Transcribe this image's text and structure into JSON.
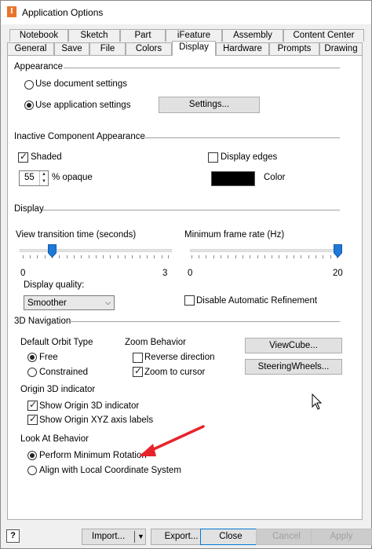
{
  "window": {
    "title": "Application Options",
    "app_icon_glyph": "I"
  },
  "tabs": {
    "row1": [
      "Notebook",
      "Sketch",
      "Part",
      "iFeature",
      "Assembly",
      "Content Center"
    ],
    "row2": [
      "General",
      "Save",
      "File",
      "Colors",
      "Display",
      "Hardware",
      "Prompts",
      "Drawing"
    ],
    "active": "Display"
  },
  "appearance": {
    "heading": "Appearance",
    "use_document": "Use document settings",
    "use_application": "Use application settings",
    "selected": "application",
    "settings_button": "Settings..."
  },
  "inactive": {
    "heading": "Inactive Component Appearance",
    "shaded_label": "Shaded",
    "shaded_checked": true,
    "opacity_value": "55",
    "opacity_suffix": "% opaque",
    "display_edges_label": "Display edges",
    "display_edges_checked": false,
    "color_label": "Color",
    "color_value": "#000000"
  },
  "display": {
    "heading": "Display",
    "view_transition_label": "View transition time (seconds)",
    "view_transition_min": "0",
    "view_transition_max": "3",
    "view_transition_value": 0.6,
    "min_frame_label": "Minimum frame rate (Hz)",
    "min_frame_min": "0",
    "min_frame_max": "20",
    "min_frame_value": 20,
    "quality_label": "Display quality:",
    "quality_value": "Smoother",
    "disable_refinement_label": "Disable Automatic Refinement",
    "disable_refinement_checked": false
  },
  "nav3d": {
    "heading": "3D Navigation",
    "orbit_heading": "Default Orbit Type",
    "orbit_free": "Free",
    "orbit_constrained": "Constrained",
    "orbit_selected": "free",
    "zoom_heading": "Zoom Behavior",
    "reverse_direction": "Reverse direction",
    "reverse_checked": false,
    "zoom_to_cursor": "Zoom to cursor",
    "zoom_to_cursor_checked": true,
    "viewcube_button": "ViewCube...",
    "steeringwheels_button": "SteeringWheels...",
    "origin_heading": "Origin 3D indicator",
    "show_origin": "Show Origin 3D indicator",
    "show_origin_checked": true,
    "show_xyz": "Show Origin XYZ axis labels",
    "show_xyz_checked": true,
    "lookat_heading": "Look At Behavior",
    "perform_min_rotation": "Perform Minimum Rotation",
    "align_local": "Align with Local Coordinate System",
    "lookat_selected": "minimum"
  },
  "footer": {
    "help_glyph": "?",
    "import_button": "Import...",
    "export_button": "Export...",
    "close_button": "Close",
    "cancel_button": "Cancel",
    "apply_button": "Apply"
  },
  "colors": {
    "annotation_arrow": "#e8232a",
    "slider_thumb": "#1e78d7"
  }
}
